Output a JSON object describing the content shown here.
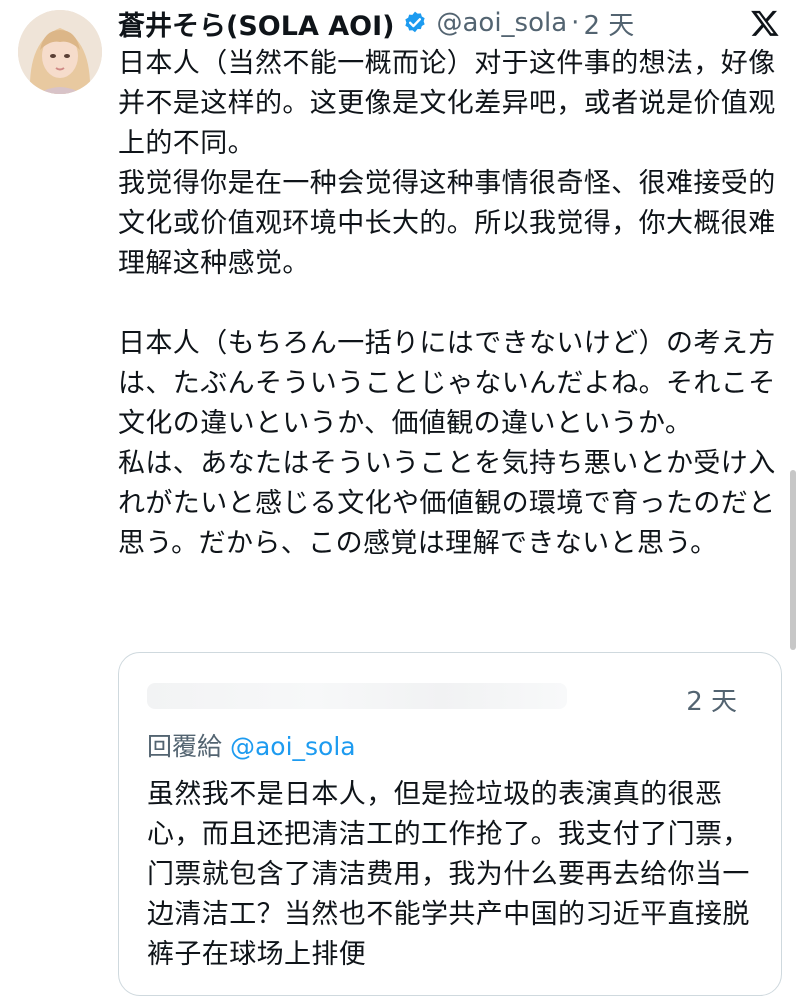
{
  "author": {
    "display_name": "蒼井そら(SOLA AOI)",
    "handle": "@aoi_sola",
    "separator": "·",
    "time": "2 天",
    "verified_icon": "verified-badge-icon",
    "avatar_icon": "profile-avatar"
  },
  "platform_icon": "x-logo-icon",
  "tweet": {
    "paragraphs": [
      "日本人（当然不能一概而论）对于这件事的想法，好像并不是这样的。这更像是文化差异吧，或者说是价值观上的不同。",
      "我觉得你是在一种会觉得这种事情很奇怪、很难接受的文化或价值观环境中长大的。所以我觉得，你大概很难理解这种感觉。",
      "日本人（もちろん一括りにはできないけど）の考え方は、たぶんそういうことじゃないんだよね。それこそ文化の違いというか、価値観の違いというか。",
      "私は、あなたはそういうことを気持ち悪いとか受け入れがたいと感じる文化や価値観の環境で育ったのだと思う。だから、この感覚は理解できないと思う。"
    ]
  },
  "quote": {
    "time": "2 天",
    "reply_prefix": "回覆給",
    "reply_handle": "@aoi_sola",
    "text": "虽然我不是日本人，但是捡垃圾的表演真的很恶心，而且还把清洁工的工作抢了。我支付了门票，门票就包含了清洁费用，我为什么要再去给你当一边清洁工？当然也不能学共产中国的习近平直接脱裤子在球场上排便"
  },
  "colors": {
    "text": "#0f1419",
    "secondary": "#536471",
    "link": "#1d9bf0",
    "border": "#cfd9de"
  }
}
